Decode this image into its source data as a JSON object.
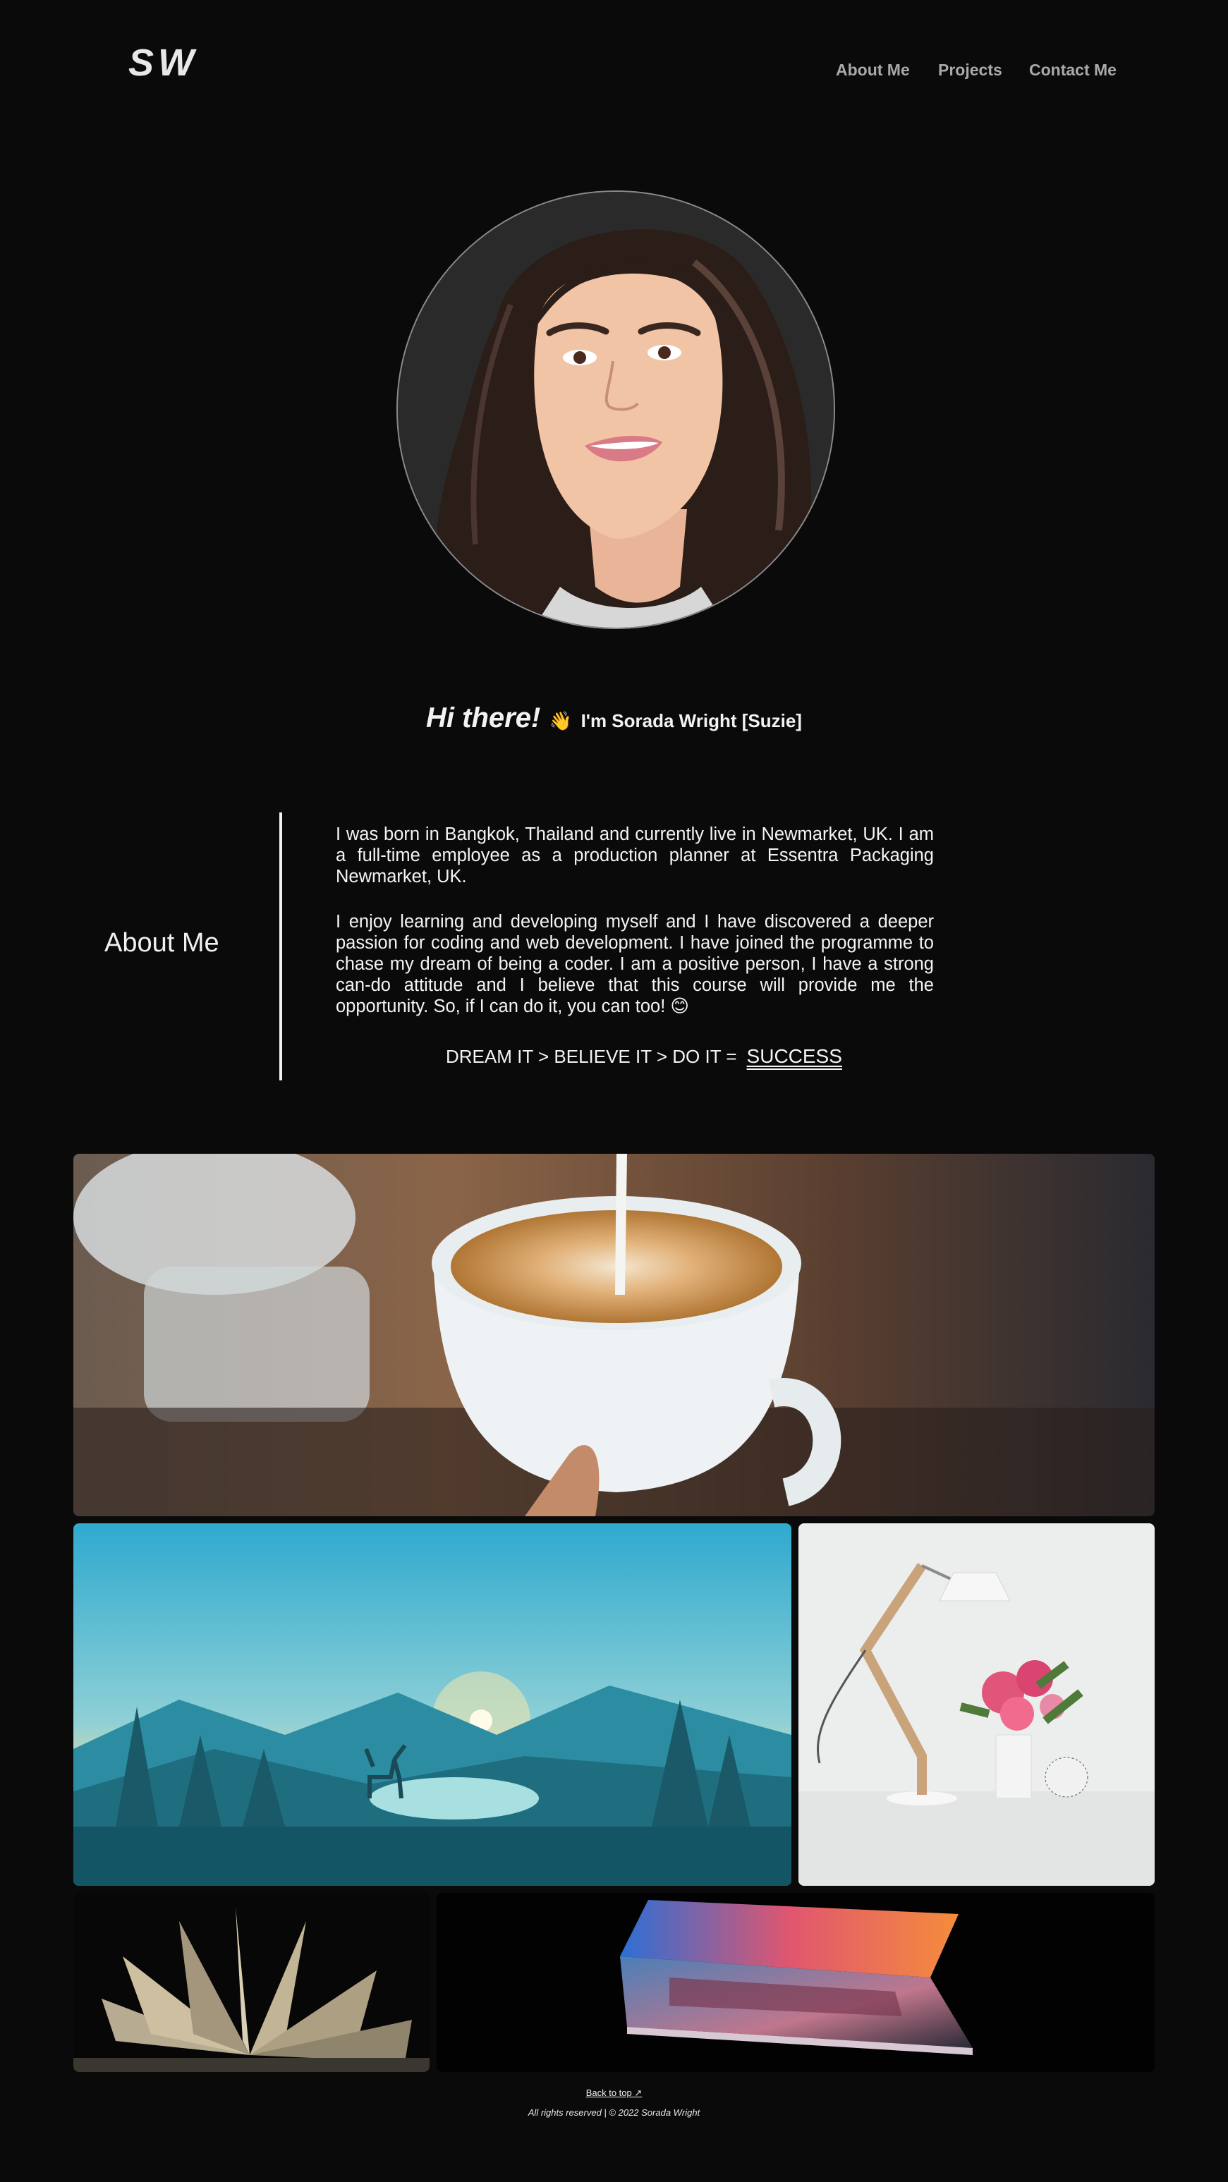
{
  "header": {
    "logo": "SW",
    "nav": [
      "About Me",
      "Projects",
      "Contact Me"
    ]
  },
  "hero": {
    "greeting": "Hi there!",
    "wave_icon": "waving-hand-icon",
    "intro": "I'm Sorada Wright [Suzie]"
  },
  "about": {
    "title": "About Me",
    "paragraph1": "I was born in Bangkok, Thailand and currently live in Newmarket, UK. I am a full-time employee as a production planner at Essentra Packaging Newmarket, UK.",
    "paragraph2": "I enjoy learning and developing myself and I have discovered a deeper passion for coding and web development. I have joined the programme to chase my dream of being a coder. I am a positive person, I have a strong can-do attitude and I believe that this course will provide me the opportunity. So, if I can do it, you can too!",
    "emoji": "😊",
    "motto": "DREAM IT > BELIEVE IT > DO IT =",
    "motto_highlight": "SUCCESS"
  },
  "gallery": [
    "coffee-latte-art",
    "mountain-lake-deer-illustration",
    "desk-lamp-and-flowers",
    "open-book",
    "laptop-glow"
  ],
  "footer": {
    "back_to_top": "Back to top ↗",
    "rights": "All rights reserved | © 2022 Sorada Wright"
  },
  "colors": {
    "background": "#0a0a0a",
    "text": "#f2f2f2",
    "nav": "#a9a9a9"
  }
}
